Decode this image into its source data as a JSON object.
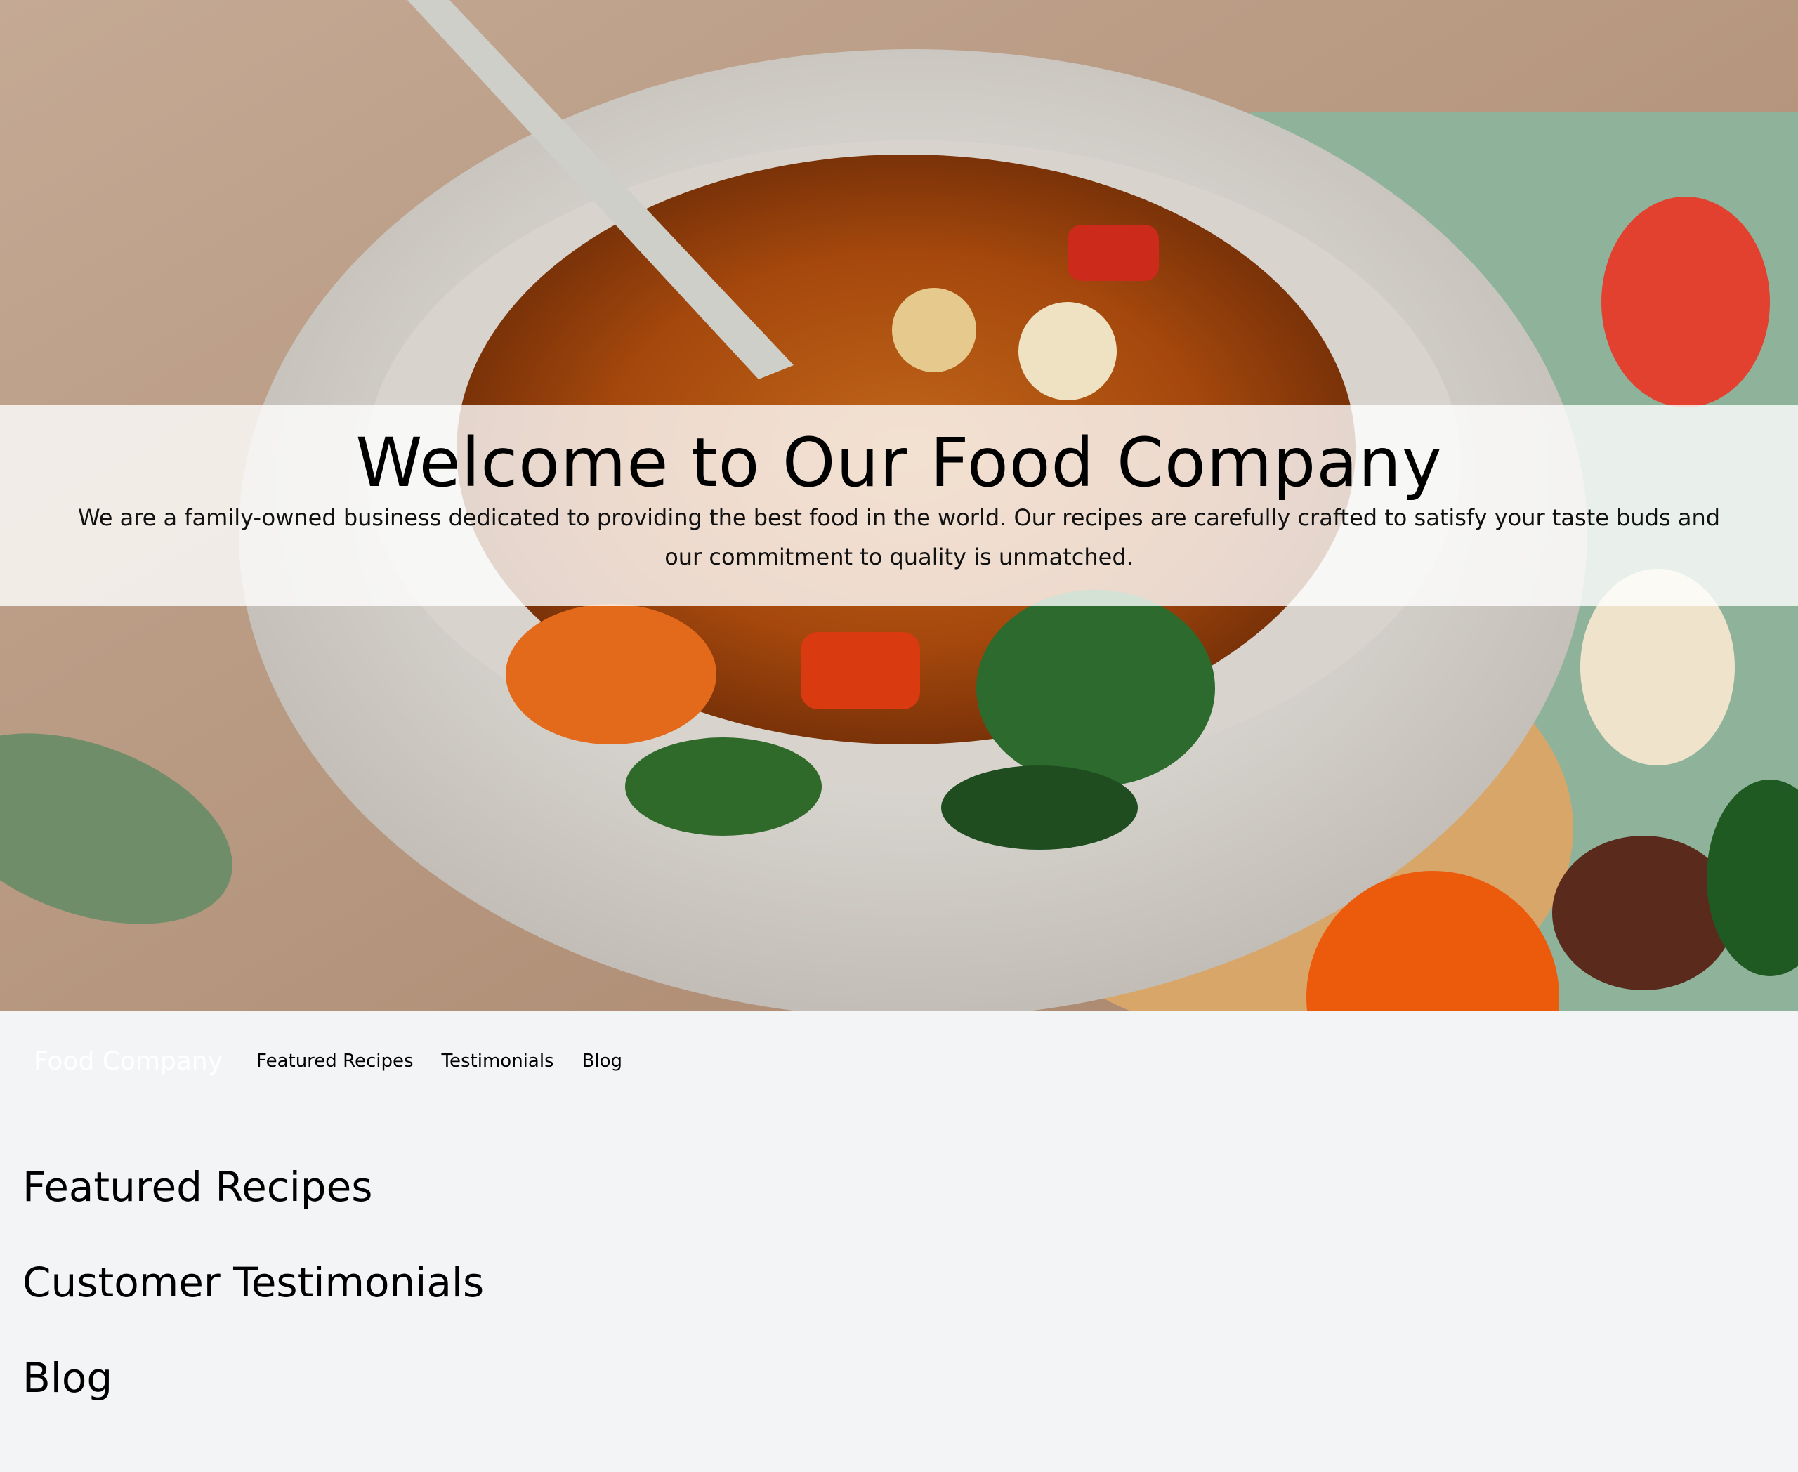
{
  "hero": {
    "image_alt": "Bowl of vegetable soup with mushrooms, peppers, tomatoes and spinach",
    "title": "Welcome to Our Food Company",
    "text": "We are a family-owned business dedicated to providing the best food in the world. Our recipes are carefully crafted to satisfy your taste buds and our commitment to quality is unmatched."
  },
  "nav": {
    "brand": "Food Company",
    "links": [
      {
        "label": "Featured Recipes"
      },
      {
        "label": "Testimonials"
      },
      {
        "label": "Blog"
      }
    ]
  },
  "sections": [
    {
      "title": "Featured Recipes"
    },
    {
      "title": "Customer Testimonials"
    },
    {
      "title": "Blog"
    }
  ],
  "colors": {
    "page_background": "#f3f4f6",
    "brand_text": "#ffffff",
    "overlay": "rgba(255,255,255,0.80)"
  }
}
